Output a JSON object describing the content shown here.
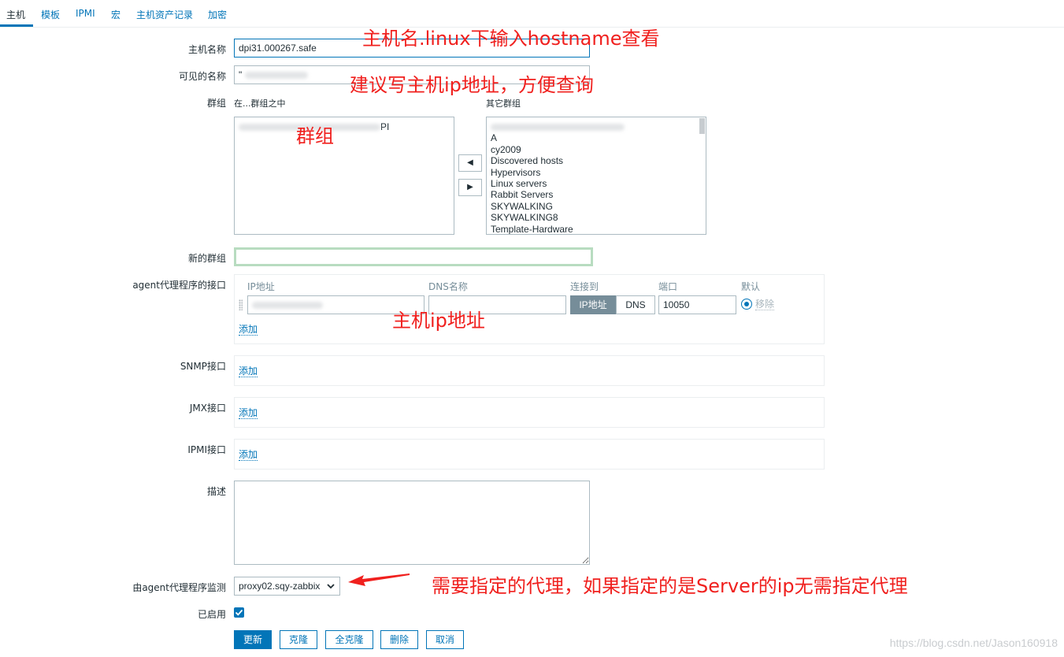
{
  "tabs": [
    {
      "label": "主机"
    },
    {
      "label": "模板"
    },
    {
      "label": "IPMI"
    },
    {
      "label": "宏"
    },
    {
      "label": "主机资产记录"
    },
    {
      "label": "加密"
    }
  ],
  "form": {
    "host_name_label": "主机名称",
    "host_name_value": "dpi31.000267.safe",
    "visible_name_label": "可见的名称",
    "visible_name_prefix": "\"",
    "groups_label": "群组",
    "in_groups_label": "在...群组之中",
    "other_groups_label": "其它群组",
    "in_groups_item_suffix": "PI",
    "other_groups": [
      "A",
      "cy2009",
      "Discovered hosts",
      "Hypervisors",
      "Linux servers",
      "Rabbit Servers",
      "SKYWALKING",
      "SKYWALKING8",
      "Template-Hardware"
    ],
    "move_left": "◀",
    "move_right": "▶",
    "new_group_label": "新的群组",
    "new_group_value": "",
    "agent_interface_label": "agent代理程序的接口",
    "col_ip": "IP地址",
    "col_dns": "DNS名称",
    "col_connect": "连接到",
    "col_port": "端口",
    "col_default": "默认",
    "connect_ip": "IP地址",
    "connect_dns": "DNS",
    "port_value": "10050",
    "remove_label": "移除",
    "add_label": "添加",
    "snmp_label": "SNMP接口",
    "jmx_label": "JMX接口",
    "ipmi_label": "IPMI接口",
    "description_label": "描述",
    "description_value": "",
    "proxy_label": "由agent代理程序监测",
    "proxy_value": "proxy02.sqy-zabbix",
    "enabled_label": "已启用",
    "enabled": true
  },
  "buttons": {
    "update": "更新",
    "clone": "克隆",
    "full_clone": "全克隆",
    "delete": "删除",
    "cancel": "取消"
  },
  "annotations": {
    "hostname_note": "主机名.linux下输入hostname查看",
    "visible_name_note": "建议写主机ip地址，方便查询",
    "groups_note": "群组",
    "host_ip_note": "主机ip地址",
    "proxy_note": "需要指定的代理，如果指定的是Server的ip无需指定代理"
  },
  "colors": {
    "accent": "#0275b8",
    "annotation": "#f0201e",
    "new_group_border": "#b8dcc0"
  },
  "watermark": "https://blog.csdn.net/Jason160918"
}
